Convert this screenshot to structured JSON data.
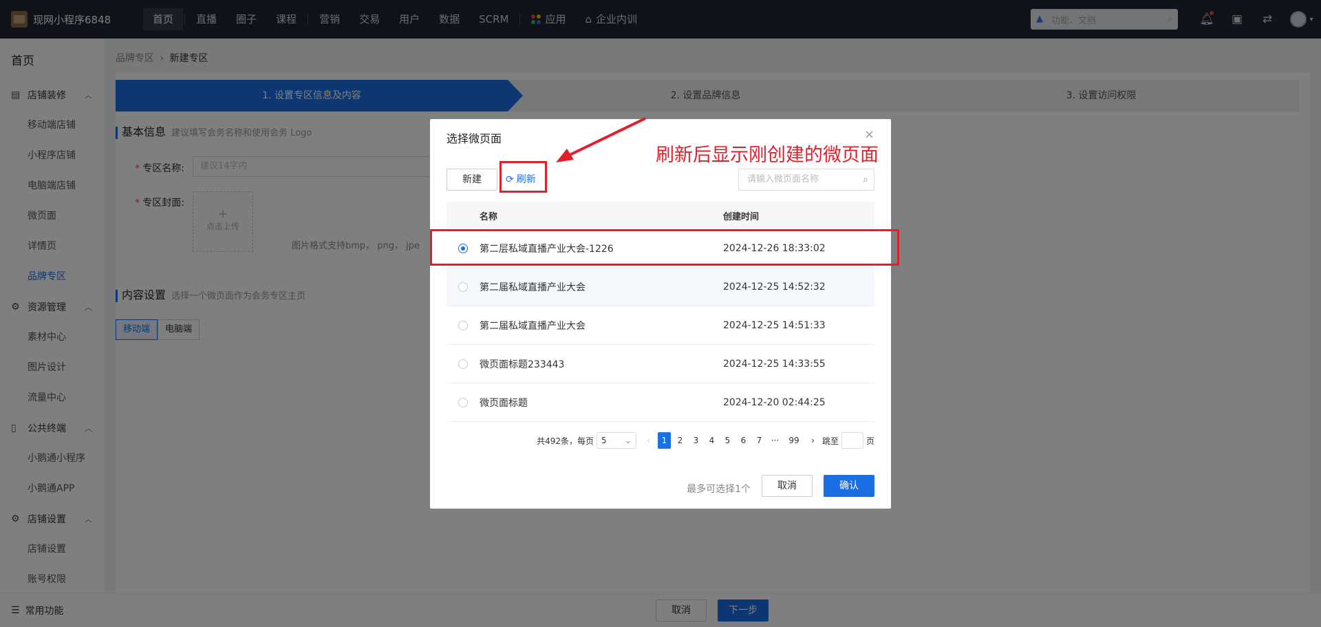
{
  "app": {
    "name": "现网小程序6848"
  },
  "topnav": {
    "items": [
      "首页",
      "直播",
      "圈子",
      "课程",
      "营销",
      "交易",
      "用户",
      "数据",
      "SCRM",
      "应用",
      "企业内训"
    ],
    "search_placeholder": "功能、文档"
  },
  "sidebar": {
    "home": "首页",
    "groups": [
      {
        "label": "店铺装修",
        "items": [
          "移动端店铺",
          "小程序店铺",
          "电脑端店铺",
          "微页面",
          "详情页",
          "品牌专区"
        ]
      },
      {
        "label": "资源管理",
        "items": [
          "素材中心",
          "图片设计",
          "流量中心"
        ]
      },
      {
        "label": "公共终端",
        "items": [
          "小鹅通小程序",
          "小鹅通APP"
        ]
      },
      {
        "label": "店铺设置",
        "items": [
          "店铺设置",
          "账号权限"
        ]
      }
    ],
    "active_item": "品牌专区",
    "bottom": "常用功能"
  },
  "breadcrumb": {
    "parent": "品牌专区",
    "separator": "›",
    "current": "新建专区"
  },
  "steps": [
    "1. 设置专区信息及内容",
    "2. 设置品牌信息",
    "3. 设置访问权限"
  ],
  "basic": {
    "title": "基本信息",
    "subtitle": "建议填写会务名称和使用会务 Logo",
    "name_label": "专区名称:",
    "name_placeholder": "建议14字内",
    "cover_label": "专区封面:",
    "upload_plus": "+",
    "upload_text": "点击上传",
    "upload_hint": "图片格式支持bmp， png， jpe"
  },
  "content": {
    "title": "内容设置",
    "subtitle": "选择一个微页面作为会务专区主页",
    "tabs": [
      "移动端",
      "电脑端"
    ]
  },
  "footer": {
    "cancel": "取消",
    "next": "下一步"
  },
  "modal": {
    "title": "选择微页面",
    "close": "×",
    "new_label": "新建",
    "refresh_label": "刷新",
    "search_placeholder": "请输入微页面名称",
    "columns": [
      "名称",
      "创建时间"
    ],
    "rows": [
      {
        "name": "第二层私域直播产业大会-1226",
        "time": "2024-12-26 18:33:02",
        "selected": true
      },
      {
        "name": "第二届私域直播产业大会",
        "time": "2024-12-25 14:52:32",
        "selected": false
      },
      {
        "name": "第二届私域直播产业大会",
        "time": "2024-12-25 14:51:33",
        "selected": false
      },
      {
        "name": "微页面标题233443",
        "time": "2024-12-25 14:33:55",
        "selected": false
      },
      {
        "name": "微页面标题",
        "time": "2024-12-20 02:44:25",
        "selected": false
      }
    ],
    "pagination": {
      "total_text": "共492条，每页",
      "page_size": "5",
      "prev": "‹",
      "pages": [
        "1",
        "2",
        "3",
        "4",
        "5",
        "6",
        "7",
        "···",
        "99"
      ],
      "current": "1",
      "next": "›",
      "jump_label": "跳至",
      "jump_unit": "页"
    },
    "limit_hint": "最多可选择1个",
    "cancel": "取消",
    "confirm": "确认"
  },
  "annotation": {
    "text": "刷新后显示刚创建的微页面",
    "color": "#e11f2b"
  },
  "colors": {
    "primary": "#1b6fe5",
    "topbar": "#1f2430"
  }
}
